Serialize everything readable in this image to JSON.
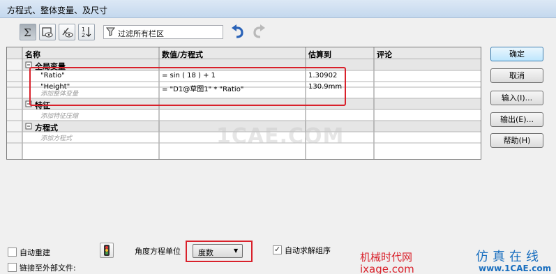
{
  "window": {
    "title": "方程式、整体变量、及尺寸"
  },
  "toolbar": {
    "buttons": [
      {
        "icon": "sigma-icon"
      },
      {
        "icon": "folder-view-icon"
      },
      {
        "icon": "dimension-view-icon"
      },
      {
        "icon": "sort-order-icon"
      }
    ],
    "filter_placeholder": "过滤所有栏区",
    "undo_icon": "undo-icon",
    "redo_icon": "redo-icon"
  },
  "table": {
    "headers": [
      "名称",
      "数值/方程式",
      "估算到",
      "评论"
    ],
    "sections": [
      {
        "title": "全局变量",
        "rows": [
          {
            "name": "\"Ratio\"",
            "value": "= sin ( 18 ) + 1",
            "eval": "1.30902",
            "comment": ""
          },
          {
            "name": "\"Height\"",
            "value": "= \"D1@草图1\" * \"Ratio\"",
            "eval": "130.9mm",
            "comment": ""
          }
        ],
        "add_hint": "添加整体变量"
      },
      {
        "title": "特征",
        "rows": [],
        "add_hint": "添加特征压缩"
      },
      {
        "title": "方程式",
        "rows": [],
        "add_hint": "添加方程式"
      }
    ]
  },
  "side_buttons": [
    "确定",
    "取消",
    "输入(I)...",
    "输出(E)...",
    "帮助(H)"
  ],
  "bottom": {
    "auto_rebuild": {
      "label": "自动重建",
      "checked": false
    },
    "link_external": {
      "label": "链接至外部文件:",
      "checked": false
    },
    "angle_unit_label": "角度方程单位",
    "angle_unit_value": "度数",
    "auto_solve_order": {
      "label": "自动求解组序",
      "checked": true
    }
  },
  "watermarks": {
    "center": "1CAE.COM",
    "brand_cn": "机械时代网",
    "brand_url": "ixage.com",
    "sim_cn": "仿真在线",
    "sim_url": "www.1CAE.com"
  },
  "colors": {
    "highlight_red": "#d9212b",
    "section_bg": "#e6e6e6",
    "watermark_red": "#d9212b",
    "watermark_blue": "#1a6fbf"
  }
}
